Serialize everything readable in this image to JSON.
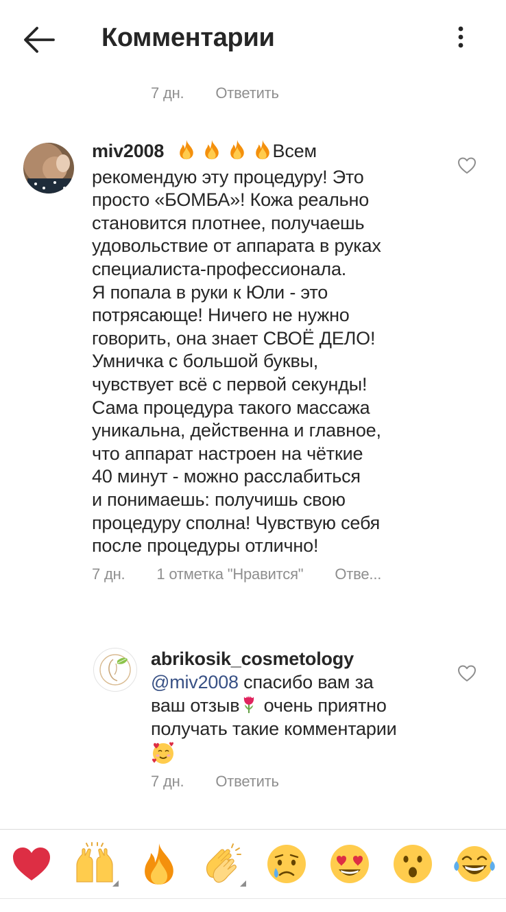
{
  "header": {
    "title": "Комментарии"
  },
  "top_meta": {
    "time": "7 дн.",
    "reply": "Ответить"
  },
  "comment": {
    "username": "miv2008",
    "lines": [
      "Всем",
      "рекомендую эту процедуру! Это",
      "просто «БОМБА»! Кожа реально",
      "становится плотнее, получаешь",
      "удовольствие от аппарата в руках",
      "специалиста-профессионала.",
      "Я попала в руки к Юли - это",
      "потрясающе! Ничего не нужно",
      "говорить, она знает СВОЁ ДЕЛО!",
      "Умничка с большой буквы,",
      "чувствует всё с первой секунды!",
      "Сама процедура такого массажа",
      "уникальна, действенна и главное,",
      "что аппарат настроен на чёткие",
      "40 минут - можно расслабиться",
      "и понимаешь: получишь свою",
      "процедуру сполна! Чувствую себя",
      "после процедуры отлично!"
    ],
    "time": "7 дн.",
    "likes": "1 отметка \"Нравится\"",
    "reply": "Отве..."
  },
  "reply_comment": {
    "username": "abrikosik_cosmetology",
    "mention": "@miv2008",
    "text_1": " спасибо вам за",
    "text_2a": "ваш отзыв",
    "text_2b": " очень приятно",
    "text_3": "получать такие комментарии",
    "time": "7 дн.",
    "reply": "Ответить"
  },
  "emoji_bar": [
    "heart",
    "raising-hands",
    "fire",
    "clapping-hands",
    "crying-face",
    "heart-eyes-face",
    "astonished-face",
    "tears-of-joy-face"
  ],
  "colors": {
    "text": "#262626",
    "meta": "#8e8e8e",
    "mention": "#385185",
    "divider": "#dbdbdb"
  }
}
